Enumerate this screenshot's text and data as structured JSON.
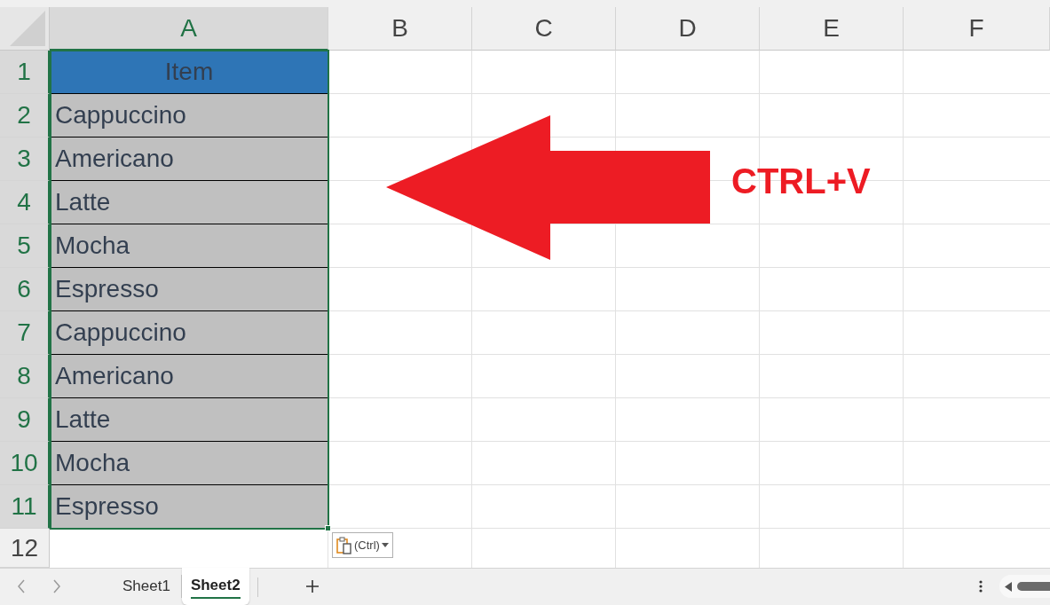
{
  "columns": [
    {
      "label": "A",
      "selected": true
    },
    {
      "label": "B",
      "selected": false
    },
    {
      "label": "C",
      "selected": false
    },
    {
      "label": "D",
      "selected": false
    },
    {
      "label": "E",
      "selected": false
    },
    {
      "label": "F",
      "selected": false
    }
  ],
  "rows": [
    {
      "number": "1",
      "selected": true,
      "kind": "header",
      "item": "Item"
    },
    {
      "number": "2",
      "selected": true,
      "kind": "data",
      "item": "Cappuccino"
    },
    {
      "number": "3",
      "selected": true,
      "kind": "data",
      "item": "Americano"
    },
    {
      "number": "4",
      "selected": true,
      "kind": "data",
      "item": "Latte"
    },
    {
      "number": "5",
      "selected": true,
      "kind": "data",
      "item": "Mocha"
    },
    {
      "number": "6",
      "selected": true,
      "kind": "data",
      "item": "Espresso"
    },
    {
      "number": "7",
      "selected": true,
      "kind": "data",
      "item": "Cappuccino"
    },
    {
      "number": "8",
      "selected": true,
      "kind": "data",
      "item": "Americano"
    },
    {
      "number": "9",
      "selected": true,
      "kind": "data",
      "item": "Latte"
    },
    {
      "number": "10",
      "selected": true,
      "kind": "data",
      "item": "Mocha"
    },
    {
      "number": "11",
      "selected": true,
      "kind": "data",
      "item": "Espresso"
    },
    {
      "number": "12",
      "selected": false,
      "kind": "empty"
    }
  ],
  "annotation": {
    "text": "CTRL+V"
  },
  "paste_options": {
    "label": "(Ctrl)"
  },
  "sheet_tabs": [
    {
      "label": "Sheet1",
      "selected": false
    },
    {
      "label": "Sheet2",
      "selected": true
    }
  ]
}
